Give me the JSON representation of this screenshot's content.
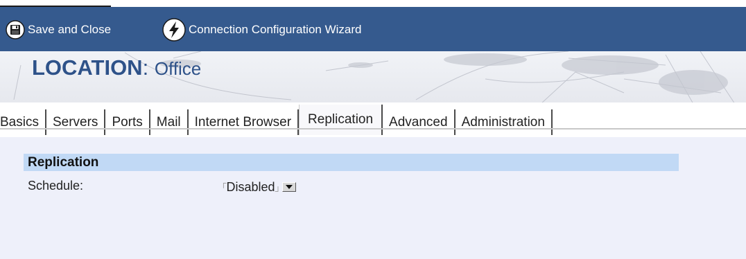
{
  "toolbar": {
    "save_label": "Save and Close",
    "wizard_label": "Connection Configuration Wizard"
  },
  "banner": {
    "title_prefix": "LOCATION",
    "separator": ":",
    "title_name": "Office"
  },
  "tabs": [
    {
      "label": "Basics",
      "active": false
    },
    {
      "label": "Servers",
      "active": false
    },
    {
      "label": "Ports",
      "active": false
    },
    {
      "label": "Mail",
      "active": false
    },
    {
      "label": "Internet Browser",
      "active": false
    },
    {
      "label": "Replication",
      "active": true
    },
    {
      "label": "Advanced",
      "active": false
    },
    {
      "label": "Administration",
      "active": false
    }
  ],
  "section": {
    "title": "Replication"
  },
  "fields": {
    "schedule": {
      "label": "Schedule:",
      "value": "Disabled"
    }
  },
  "colors": {
    "toolbar_bg": "#355a8e",
    "title_blue": "#2e5289",
    "section_header_bg": "#c1d9f5",
    "page_bg": "#eef0fa"
  },
  "icons": {
    "save": "floppy-disk-icon",
    "wizard": "lightning-bolt-icon",
    "dropdown": "dropdown-arrow-icon"
  }
}
